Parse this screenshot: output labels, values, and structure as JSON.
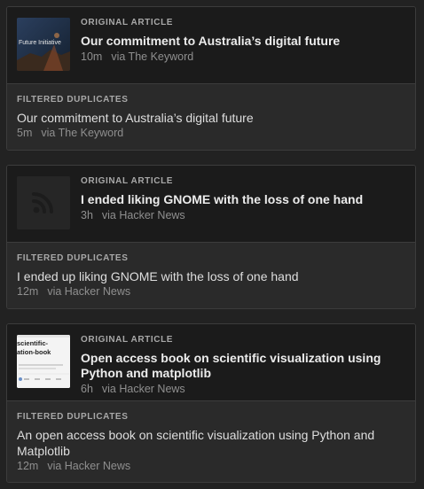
{
  "labels": {
    "original": "ORIGINAL ARTICLE",
    "duplicates": "FILTERED DUPLICATES"
  },
  "articles": [
    {
      "original": {
        "thumbnail": "Future Initiative",
        "title": "Our commitment to Australia’s digital future",
        "time": "10m",
        "source": "via The Keyword"
      },
      "duplicates": [
        {
          "title": "Our commitment to Australia’s digital future",
          "time": "5m",
          "source": "via The Keyword"
        }
      ]
    },
    {
      "original": {
        "thumbnail": "rss-icon",
        "title": "I ended liking GNOME with the loss of one hand",
        "time": "3h",
        "source": "via Hacker News"
      },
      "duplicates": [
        {
          "title": "I ended up liking GNOME with the loss of one hand",
          "time": "12m",
          "source": "via Hacker News"
        }
      ]
    },
    {
      "original": {
        "thumbnail": "scientific-visualization-book",
        "thumb_text": "scientific-\nation-book",
        "title": "Open access book on scientific visualization using Python and matplotlib",
        "time": "6h",
        "source": "via Hacker News"
      },
      "duplicates": [
        {
          "title": "An open access book on scientific visualization using Python and Matplotlib",
          "time": "12m",
          "source": "via Hacker News"
        }
      ]
    }
  ]
}
